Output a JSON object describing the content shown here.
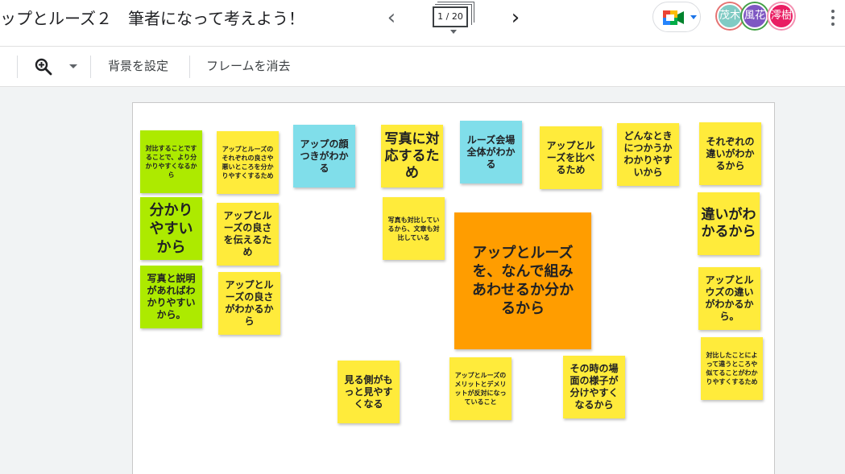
{
  "header": {
    "title": "ップとルーズ２　筆者になって考えよう！",
    "frame_counter": "1 / 20",
    "avatars": [
      {
        "label": "茂木",
        "color": "#80cbc4",
        "ring": "#e57373"
      },
      {
        "label": "風花",
        "color": "#7e57c2",
        "ring": "#43a047"
      },
      {
        "label": "澪樹",
        "color": "#e91e63",
        "ring": "#f48fb1"
      }
    ]
  },
  "toolbar": {
    "set_background": "背景を設定",
    "clear_frame": "フレームを消去"
  },
  "notes": [
    {
      "text": "対比することですることで、より分かりやすくなるから",
      "color": "green"
    },
    {
      "text": "分かりやすいから",
      "color": "green"
    },
    {
      "text": "写真と説明があればわかりやすいから。",
      "color": "green"
    },
    {
      "text": "アップとルーズのそれぞれの良さや悪いところを分かりやすくするため",
      "color": "yellow"
    },
    {
      "text": "アップとルーズの良さを伝えるため",
      "color": "yellow"
    },
    {
      "text": "アップとルーズの良さがわかるから",
      "color": "yellow"
    },
    {
      "text": "アップの顔つきがわかる",
      "color": "cyan"
    },
    {
      "text": "写真に対応するため",
      "color": "yellow"
    },
    {
      "text": "写真も対比しているから、文章も対比している",
      "color": "yellow"
    },
    {
      "text": "ルーズ会場全体がわかる",
      "color": "cyan"
    },
    {
      "text": "アップとルーズを比べるため",
      "color": "yellow"
    },
    {
      "text": "どんなときにつかうかわかりやすいから",
      "color": "yellow"
    },
    {
      "text": "それぞれの違いがわかるから",
      "color": "yellow"
    },
    {
      "text": "違いがわかるから",
      "color": "yellow"
    },
    {
      "text": "アップとルウズの違いがわかるから。",
      "color": "yellow"
    },
    {
      "text": "対比したことによって違うところや似てることがわかりやすくするため",
      "color": "yellow"
    },
    {
      "text": "アップとルーズを、なんで組みあわせるか分かるから",
      "color": "orange"
    },
    {
      "text": "見る側がもっと見やすくなる",
      "color": "yellow"
    },
    {
      "text": "アップとルーズのメリットとデメリットが反対になっていること",
      "color": "yellow"
    },
    {
      "text": "その時の場面の様子が分けやすくなるから",
      "color": "yellow"
    }
  ]
}
